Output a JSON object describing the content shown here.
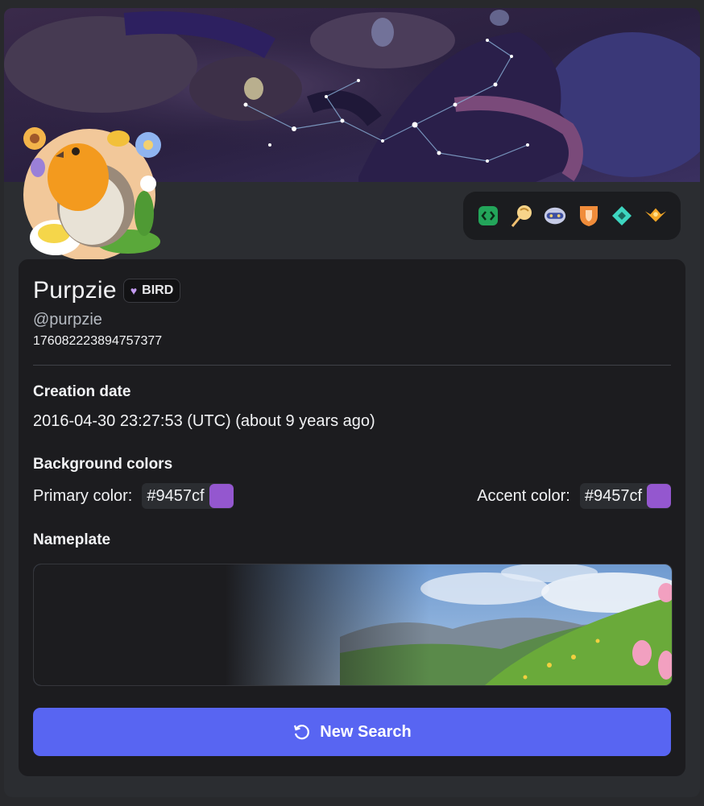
{
  "profile": {
    "display_name": "Purpzie",
    "tag": "BIRD",
    "username": "@purpzie",
    "user_id": "176082223894757377"
  },
  "creation": {
    "title": "Creation date",
    "value": "2016-04-30 23:27:53 (UTC) (about 9 years ago)"
  },
  "background_colors": {
    "title": "Background colors",
    "primary_label": "Primary color:",
    "primary_hex": "#9457cf",
    "accent_label": "Accent color:",
    "accent_hex": "#9457cf"
  },
  "nameplate": {
    "title": "Nameplate"
  },
  "actions": {
    "new_search_label": "New Search"
  },
  "badges": [
    "active-developer-badge-icon",
    "quest-badge-icon",
    "nitro-helmet-badge-icon",
    "hypesquad-bravery-badge-icon",
    "nitro-diamond-badge-icon",
    "orbs-badge-icon"
  ],
  "colors": {
    "accent": "#5865f2",
    "swatch": "#9457cf"
  }
}
